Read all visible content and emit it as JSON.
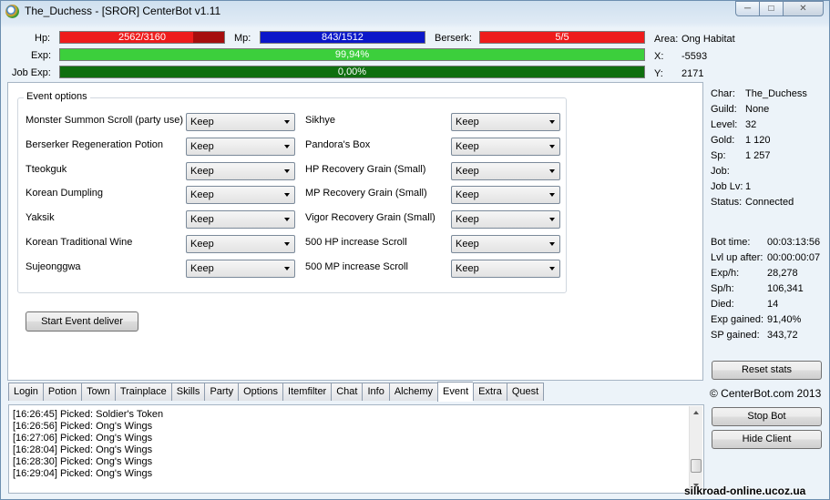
{
  "window": {
    "title": "The_Duchess - [SROR] CenterBot v1.11",
    "min_glyph": "─",
    "max_glyph": "□",
    "close_glyph": "✕"
  },
  "stats": {
    "hp": {
      "label": "Hp:",
      "text": "2562/3160",
      "fraction": 0.81
    },
    "mp": {
      "label": "Mp:",
      "text": "843/1512",
      "fraction": 1.0
    },
    "berserk": {
      "label": "Berserk:",
      "text": "5/5",
      "fraction": 1.0
    },
    "exp": {
      "label": "Exp:",
      "text": "99,94%",
      "fraction": 0.9994
    },
    "job_exp": {
      "label": "Job Exp:",
      "text": "0,00%",
      "fraction": 1.0
    },
    "area": {
      "label": "Area:",
      "value": "Ong Habitat"
    },
    "x": {
      "label": "X:",
      "value": "-5593"
    },
    "y": {
      "label": "Y:",
      "value": "2171"
    }
  },
  "colors": {
    "hp_fill": "#ee1c1c",
    "hp_empty": "#a60e0e",
    "mp_fill": "#0b17c9",
    "berserk_fill": "#ee1c1c",
    "exp_fill": "#3ccf3c",
    "job_exp_fill": "#0f6f0f"
  },
  "event_options": {
    "title": "Event options",
    "left": [
      {
        "label": "Monster Summon Scroll (party use)",
        "value": "Keep"
      },
      {
        "label": "Berserker Regeneration Potion",
        "value": "Keep"
      },
      {
        "label": "Tteokguk",
        "value": "Keep"
      },
      {
        "label": "Korean Dumpling",
        "value": "Keep"
      },
      {
        "label": "Yaksik",
        "value": "Keep"
      },
      {
        "label": "Korean Traditional Wine",
        "value": "Keep"
      },
      {
        "label": "Sujeonggwa",
        "value": "Keep"
      }
    ],
    "right": [
      {
        "label": "Sikhye",
        "value": "Keep"
      },
      {
        "label": "Pandora's Box",
        "value": "Keep"
      },
      {
        "label": "HP Recovery Grain (Small)",
        "value": "Keep"
      },
      {
        "label": "MP Recovery Grain (Small)",
        "value": "Keep"
      },
      {
        "label": "Vigor Recovery Grain (Small)",
        "value": "Keep"
      },
      {
        "label": "500 HP increase Scroll",
        "value": "Keep"
      },
      {
        "label": "500 MP increase Scroll",
        "value": "Keep"
      }
    ],
    "start_button": "Start Event deliver"
  },
  "tabs": [
    "Login",
    "Potion",
    "Town",
    "Trainplace",
    "Skills",
    "Party",
    "Options",
    "Itemfilter",
    "Chat",
    "Info",
    "Alchemy",
    "Event",
    "Extra",
    "Quest"
  ],
  "active_tab": "Event",
  "log": [
    "[16:26:45] Picked: Soldier's Token",
    "[16:26:56] Picked: Ong's Wings",
    "[16:27:06] Picked: Ong's Wings",
    "[16:28:04] Picked: Ong's Wings",
    "[16:28:30] Picked: Ong's Wings",
    "[16:29:04] Picked: Ong's Wings"
  ],
  "char_info": [
    {
      "label": "Char:",
      "value": "The_Duchess"
    },
    {
      "label": "Guild:",
      "value": "None"
    },
    {
      "label": "Level:",
      "value": "32"
    },
    {
      "label": "Gold:",
      "value": "1 120"
    },
    {
      "label": "Sp:",
      "value": "1 257"
    },
    {
      "label": "Job:",
      "value": ""
    },
    {
      "label": "Job Lv:",
      "value": "1"
    },
    {
      "label": "Status:",
      "value": "Connected"
    }
  ],
  "bot_info": [
    {
      "label": "Bot time:",
      "value": "00:03:13:56"
    },
    {
      "label": "Lvl up after:",
      "value": "00:00:00:07"
    },
    {
      "label": "Exp/h:",
      "value": "28,278"
    },
    {
      "label": "Sp/h:",
      "value": "106,341"
    },
    {
      "label": "Died:",
      "value": "14"
    },
    {
      "label": "Exp gained:",
      "value": "91,40%"
    },
    {
      "label": "SP gained:",
      "value": "343,72"
    }
  ],
  "buttons": {
    "reset_stats": "Reset stats",
    "stop_bot": "Stop Bot",
    "hide_client": "Hide Client"
  },
  "copyright": "© CenterBot.com 2013",
  "watermark": "silkroad-online.ucoz.ua"
}
